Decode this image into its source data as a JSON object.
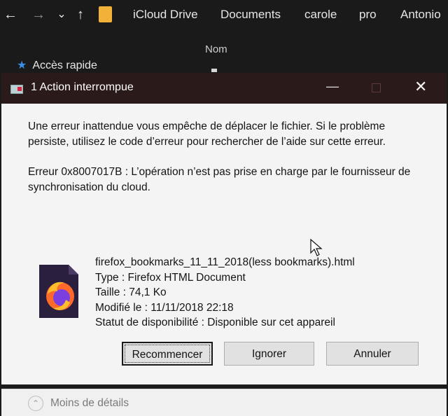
{
  "explorer": {
    "nav": {
      "back": "←",
      "forward": "→",
      "down": "⌄",
      "up": "↑"
    },
    "breadcrumbs": [
      "iCloud Drive",
      "Documents",
      "carole",
      "pro",
      "Antonio"
    ],
    "column_header": "Nom",
    "sidebar": {
      "quick_access": "Accès rapide"
    }
  },
  "dialog": {
    "title": "1 Action interrompue",
    "controls": {
      "minimize": "—",
      "close": "✕"
    },
    "message_1": "Une erreur inattendue vous empêche de déplacer le fichier. Si le problème persiste, utilisez le code d’erreur pour rechercher de l’aide sur cette erreur.",
    "message_2": "Erreur 0x8007017B : L’opération n’est pas prise en charge par le fournisseur de synchronisation du cloud.",
    "file": {
      "name": "firefox_bookmarks_11_11_2018(less bookmarks).html",
      "type": "Type : Firefox HTML Document",
      "size": "Taille : 74,1 Ko",
      "modified": "Modifié le : 11/11/2018 22:18",
      "availability": "Statut de disponibilité : Disponible sur cet appareil"
    },
    "buttons": {
      "retry": "Recommencer",
      "ignore": "Ignorer",
      "cancel": "Annuler"
    },
    "footer": {
      "less_details": "Moins de détails"
    }
  }
}
